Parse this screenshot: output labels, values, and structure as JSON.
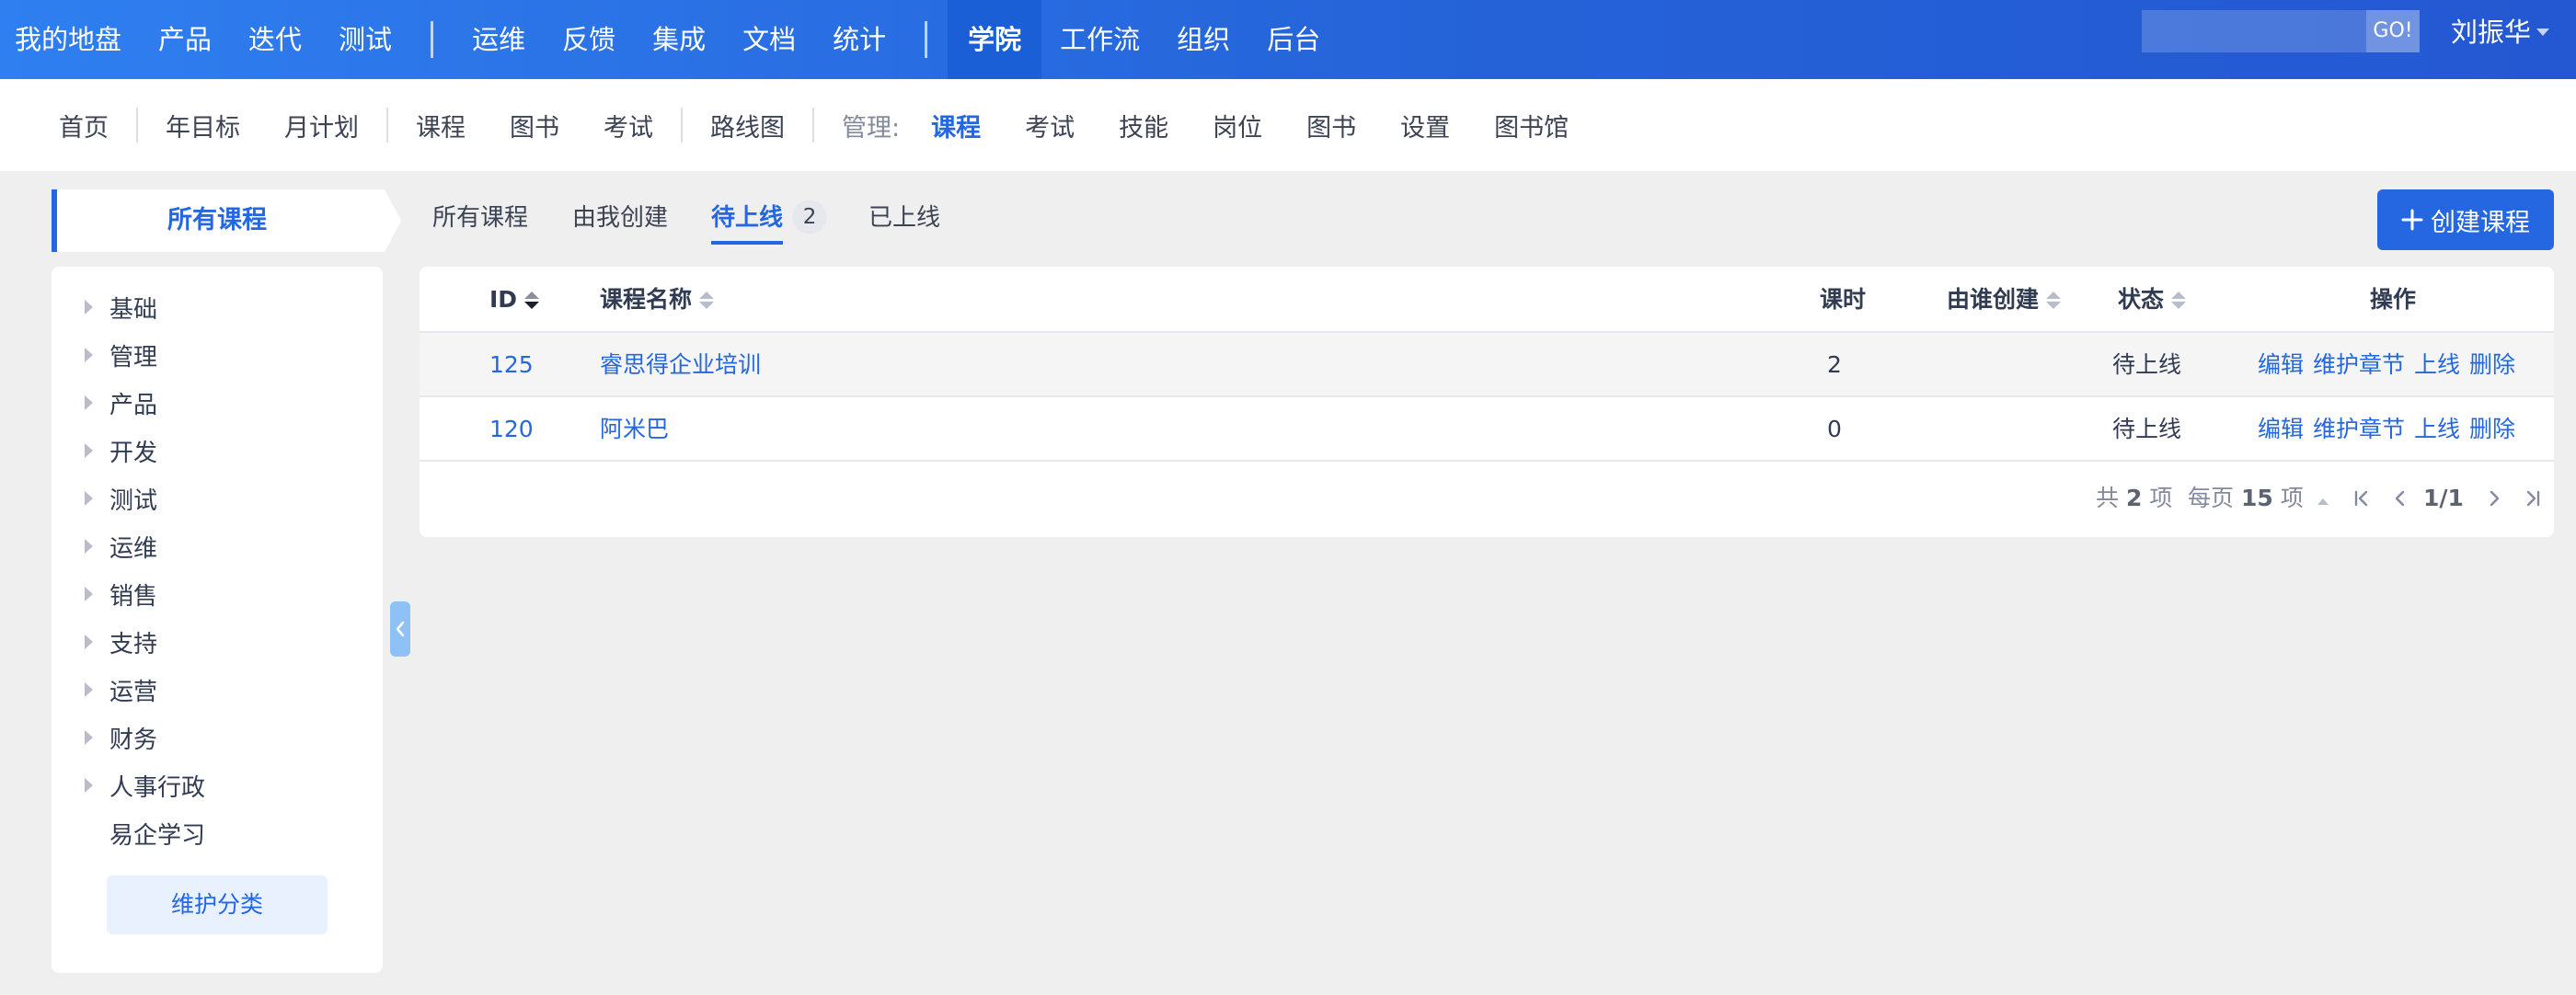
{
  "topnav": {
    "items_left": [
      "我的地盘",
      "产品",
      "迭代",
      "测试"
    ],
    "items_mid": [
      "运维",
      "反馈",
      "集成",
      "文档",
      "统计"
    ],
    "active": "学院",
    "items_right": [
      "工作流",
      "组织",
      "后台"
    ],
    "search_placeholder": "",
    "go_label": "GO!",
    "user": "刘振华"
  },
  "subnav": {
    "group1": [
      "首页"
    ],
    "group2": [
      "年目标",
      "月计划"
    ],
    "group3": [
      "课程",
      "图书",
      "考试"
    ],
    "group4": [
      "路线图"
    ],
    "manage_label": "管理:",
    "manage_active": "课程",
    "manage_items": [
      "考试",
      "技能",
      "岗位",
      "图书",
      "设置",
      "图书馆"
    ]
  },
  "sidebar": {
    "title": "所有课程",
    "items": [
      "基础",
      "管理",
      "产品",
      "开发",
      "测试",
      "运维",
      "销售",
      "支持",
      "运营",
      "财务",
      "人事行政",
      "易企学习"
    ],
    "maintain_label": "维护分类"
  },
  "tabs": {
    "all": "所有课程",
    "mine": "由我创建",
    "pending": "待上线",
    "pending_count": "2",
    "online": "已上线"
  },
  "create_button": "创建课程",
  "table": {
    "headers": {
      "id": "ID",
      "name": "课程名称",
      "hours": "课时",
      "creator": "由谁创建",
      "status": "状态",
      "actions": "操作"
    },
    "rows": [
      {
        "id": "125",
        "name": "睿思得企业培训",
        "hours": "2",
        "creator": "",
        "status": "待上线"
      },
      {
        "id": "120",
        "name": "阿米巴",
        "hours": "0",
        "creator": "",
        "status": "待上线"
      }
    ],
    "action_labels": {
      "edit": "编辑",
      "chapters": "维护章节",
      "online": "上线",
      "delete": "删除"
    }
  },
  "pager": {
    "total_prefix": "共",
    "total": "2",
    "total_suffix": "项",
    "per_page_prefix": "每页",
    "per_page": "15",
    "per_page_suffix": "项",
    "page": "1/1"
  },
  "colors": {
    "accent": "#2467e0",
    "nav_gradient_start": "#2f7ff0",
    "nav_gradient_end": "#2458d2"
  }
}
